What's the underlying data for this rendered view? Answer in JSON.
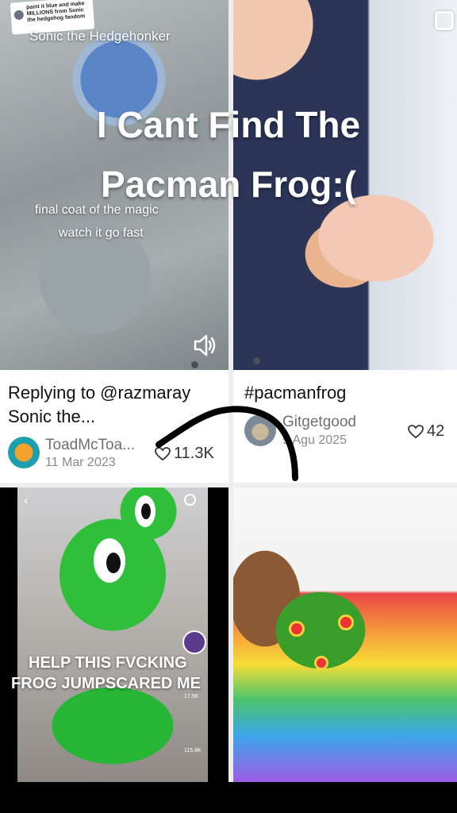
{
  "overlay": {
    "title_line1": "I Cant Find The",
    "title_line2": "Pacman Frog:("
  },
  "videos": [
    {
      "reply_sticker": "paint it blue and make MILLIONS from Sonic the hedgehog fandom",
      "thumb_title": "Sonic the Hedgehonker",
      "thumb_line1": "final coat of the magic",
      "thumb_line2": "watch it go fast",
      "caption": "Replying to @razmaray  Sonic the...",
      "username": "ToadMcToa...",
      "date": "11 Mar 2023",
      "likes": "11.3K"
    },
    {
      "caption": "#pacmanfrog",
      "username": "Gitgetgood",
      "date": "9 Agu 2025",
      "likes": "42"
    },
    {
      "thumb_text_line1": "HELP THIS FVCKING",
      "thumb_text_line2": "FROG JUMPSCARED ME",
      "side_count1": "17.5K",
      "side_count2": "115.8K"
    },
    {}
  ],
  "icons": {
    "sound": "speaker-icon",
    "heart": "heart-icon",
    "select": "select-square-icon"
  }
}
